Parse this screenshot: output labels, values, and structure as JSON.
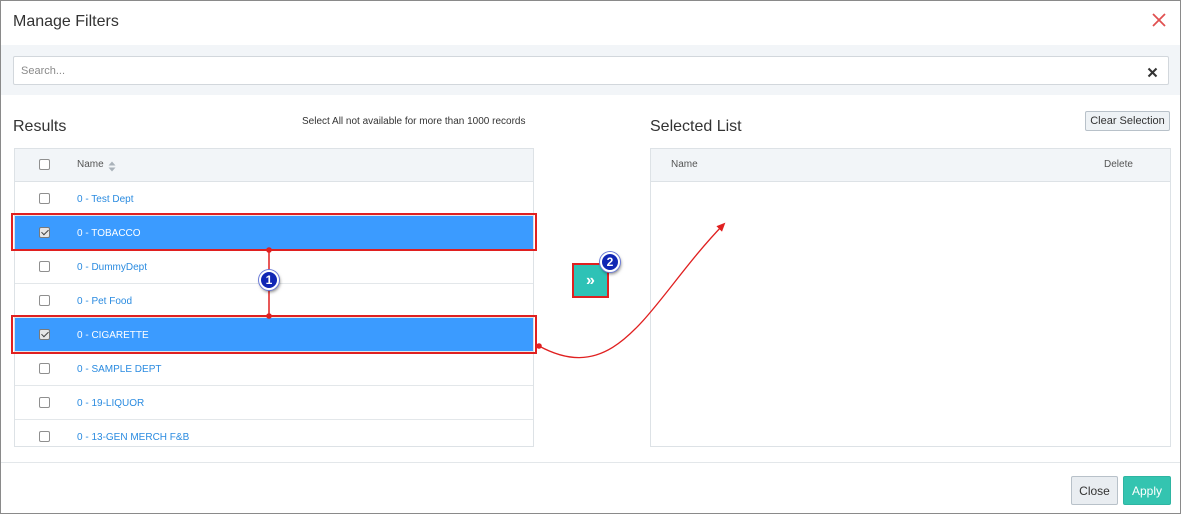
{
  "dialog": {
    "title": "Manage Filters",
    "close_icon": "close-x-icon"
  },
  "search": {
    "placeholder": "Search...",
    "value": "",
    "clear_icon": "times-icon"
  },
  "results": {
    "title": "Results",
    "note": "Select All not available for more than 1000 records",
    "columns": {
      "name": "Name"
    },
    "rows": [
      {
        "label": "0 - Test Dept",
        "checked": false
      },
      {
        "label": "0 - TOBACCO",
        "checked": true
      },
      {
        "label": "0 - DummyDept",
        "checked": false
      },
      {
        "label": "0 - Pet Food",
        "checked": false
      },
      {
        "label": "0 - CIGARETTE",
        "checked": true
      },
      {
        "label": "0 - SAMPLE DEPT",
        "checked": false
      },
      {
        "label": "0 - 19-LIQUOR",
        "checked": false
      },
      {
        "label": "0 - 13-GEN MERCH F&B",
        "checked": false
      }
    ]
  },
  "move_button": {
    "label": "»",
    "icon": "double-chevron-right-icon"
  },
  "selected": {
    "title": "Selected List",
    "clear_label": "Clear Selection",
    "columns": {
      "name": "Name",
      "delete": "Delete"
    },
    "rows": []
  },
  "annotations": {
    "step1": "1",
    "step2": "2",
    "color": "#e02020",
    "badge_color": "#1026b4"
  },
  "footer": {
    "close_label": "Close",
    "apply_label": "Apply"
  },
  "colors": {
    "selected_row": "#3b9bff",
    "link": "#2a8be0",
    "apply": "#34c4b0",
    "move_button": "#2ec2b6"
  }
}
